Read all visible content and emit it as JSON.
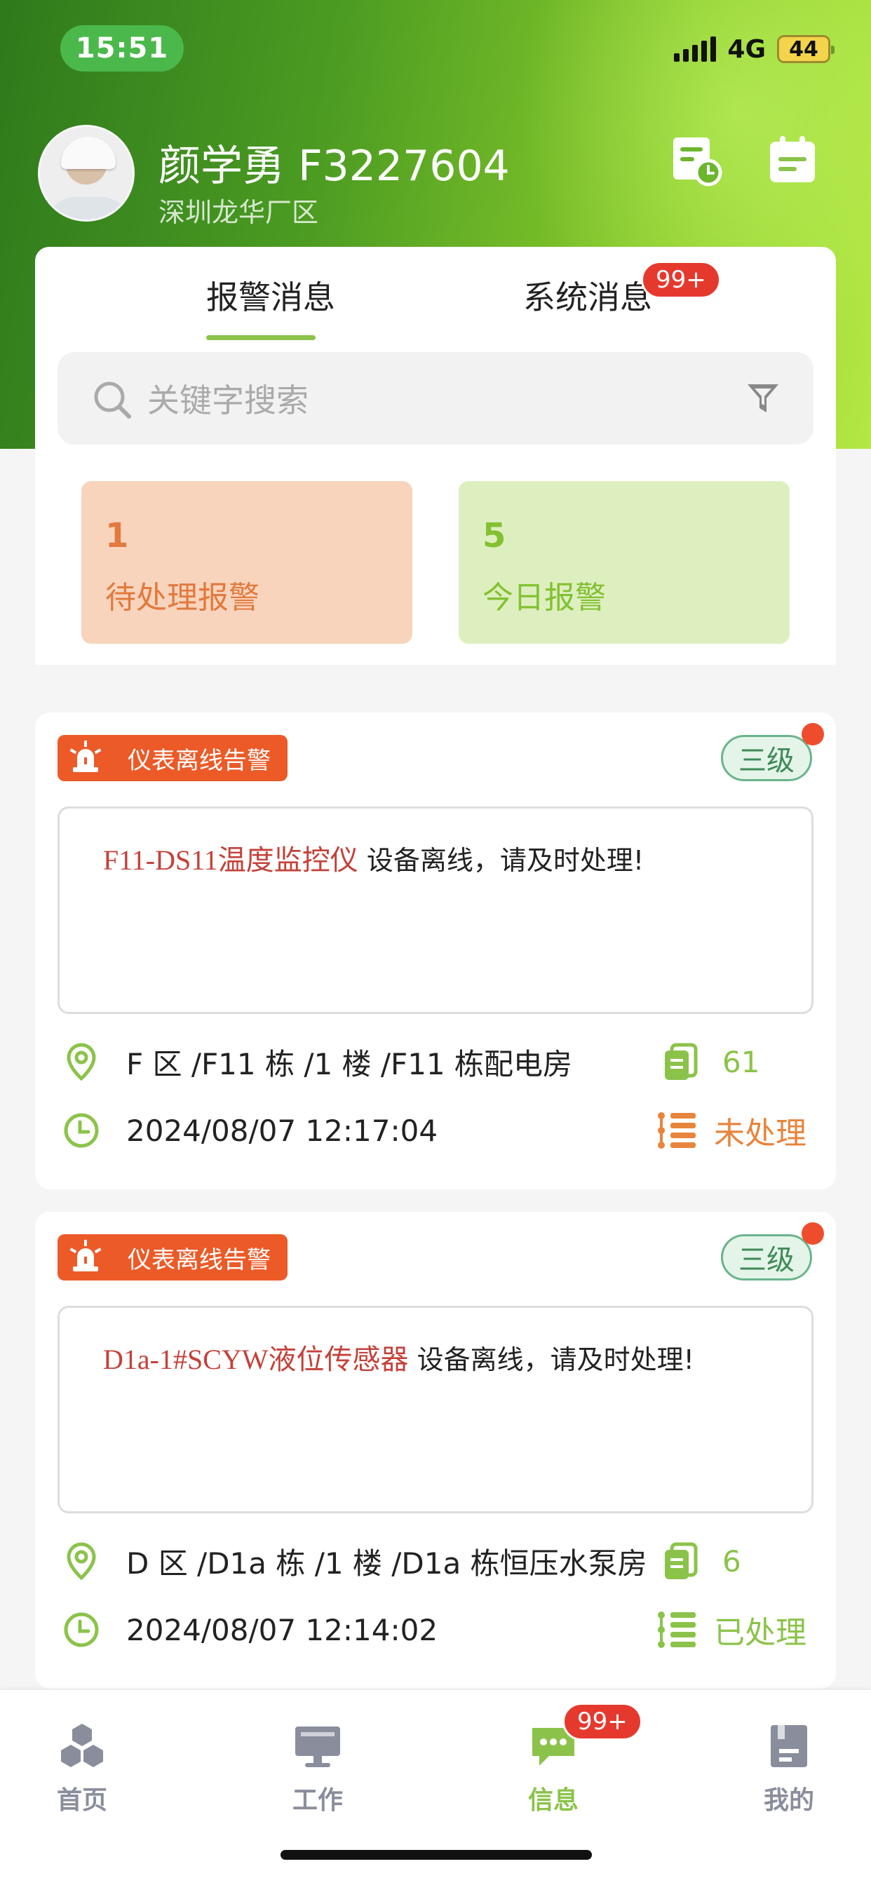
{
  "status_bar": {
    "time": "15:51",
    "network": "4G",
    "battery": "44"
  },
  "user": {
    "name": "颜学勇 F3227604",
    "site": "深圳龙华厂区"
  },
  "header_icons": [
    "report-clock-icon",
    "calendar-icon"
  ],
  "tabs": [
    {
      "label": "报警消息",
      "active": true
    },
    {
      "label": "系统消息",
      "badge": "99+"
    }
  ],
  "search": {
    "placeholder": "关键字搜索"
  },
  "stats": [
    {
      "value": "1",
      "label": "待处理报警"
    },
    {
      "value": "5",
      "label": "今日报警"
    }
  ],
  "alarms": [
    {
      "tag": "仪表离线告警",
      "level": "三级",
      "device": "F11-DS11温度监控仪",
      "message": " 设备离线，请及时处理!",
      "location": "F 区 /F11 栋 /1 楼 /F11 栋配电房",
      "count": "61",
      "time": "2024/08/07 12:17:04",
      "status": "未处理"
    },
    {
      "tag": "仪表离线告警",
      "level": "三级",
      "device": "D1a-1#SCYW液位传感器",
      "message": " 设备离线，请及时处理!",
      "location": "D 区 /D1a 栋 /1 楼 /D1a 栋恒压水泵房",
      "count": "6",
      "time": "2024/08/07 12:14:02",
      "status": "已处理"
    }
  ],
  "nav": [
    {
      "label": "首页",
      "icon": "home-icon"
    },
    {
      "label": "工作",
      "icon": "monitor-icon"
    },
    {
      "label": "信息",
      "icon": "message-icon",
      "badge": "99+",
      "active": true
    },
    {
      "label": "我的",
      "icon": "profile-icon"
    }
  ],
  "colors": {
    "brand_green": "#8bc34a",
    "pending_orange": "#e27a3e",
    "alarm_red": "#ec5a28",
    "badge_red": "#e6392e"
  }
}
